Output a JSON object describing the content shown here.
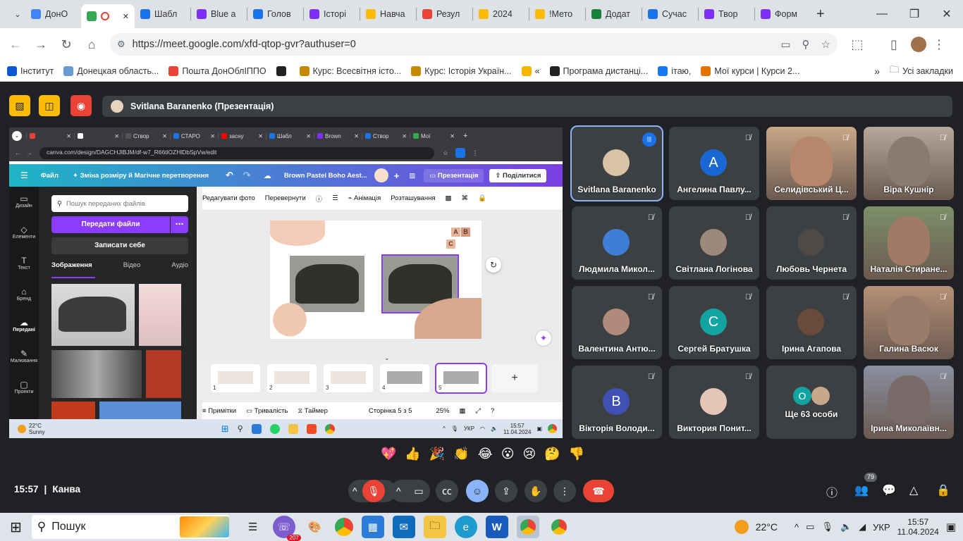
{
  "browser": {
    "tabs": [
      {
        "label": "ДонО",
        "color": "#4285f4"
      },
      {
        "label": "",
        "color": "#34a853",
        "active": true
      },
      {
        "label": "Шабл",
        "color": "#1a73e8"
      },
      {
        "label": "Blue a",
        "color": "#7b2ff7"
      },
      {
        "label": "Голов",
        "color": "#1a73e8"
      },
      {
        "label": "Історі",
        "color": "#7b2ff7"
      },
      {
        "label": "Навча",
        "color": "#fbbc04"
      },
      {
        "label": "Резул",
        "color": "#ea4335"
      },
      {
        "label": "2024",
        "color": "#fbbc04"
      },
      {
        "label": "!Мето",
        "color": "#fbbc04"
      },
      {
        "label": "Додат",
        "color": "#188038"
      },
      {
        "label": "Сучас",
        "color": "#1a73e8"
      },
      {
        "label": "Твор",
        "color": "#7b2ff7"
      },
      {
        "label": "Форм",
        "color": "#7b2ff7"
      }
    ],
    "url": "https://meet.google.com/xfd-qtop-gvr?authuser=0",
    "bookmarks": [
      {
        "label": "Інститут",
        "color": "#0b57d0"
      },
      {
        "label": "Донецкая область...",
        "color": "#6a9bd1"
      },
      {
        "label": "Пошта ДонОблІППО",
        "color": "#ea4335"
      },
      {
        "label": "",
        "color": "#222"
      },
      {
        "label": "Курс: Всесвітня істо...",
        "color": "#c58a00"
      },
      {
        "label": "Курс: Історія Україн...",
        "color": "#c58a00"
      },
      {
        "label": "«",
        "color": "#f4b400"
      },
      {
        "label": "Програма дистанці...",
        "color": "#222"
      },
      {
        "label": "ітаю,",
        "color": "#1877f2"
      },
      {
        "label": "Мої курси | Курси 2...",
        "color": "#e37400"
      }
    ],
    "all_bookmarks": "Усі закладки"
  },
  "meet": {
    "presenter_label": "Svitlana Baranenko (Презентація)",
    "participants": [
      {
        "name": "Svitlana Baranenko",
        "initial": "",
        "avatar_color": "#d9c3a5",
        "speaking": true
      },
      {
        "name": "Ангелина Павлу...",
        "initial": "A",
        "avatar_color": "#1967d2"
      },
      {
        "name": "Селидівський Ц...",
        "initial": "",
        "avatar_color": "#b8866a",
        "video": true,
        "bg": "#c9a787"
      },
      {
        "name": "Віра Кушнір",
        "initial": "",
        "avatar_color": "#8a7a70",
        "video": true,
        "bg": "#b5a89b"
      },
      {
        "name": "Людмила Микол...",
        "initial": "",
        "avatar_color": "#3f7ed6"
      },
      {
        "name": "Світлана Логінова",
        "initial": "",
        "avatar_color": "#9b8a7b"
      },
      {
        "name": "Любовь Чернета",
        "initial": "",
        "avatar_color": "#4e4a48"
      },
      {
        "name": "Наталія Стиране...",
        "initial": "",
        "avatar_color": "#a07a64",
        "video": true,
        "bg": "#7c8f6a"
      },
      {
        "name": "Валентина Антю...",
        "initial": "",
        "avatar_color": "#b08a7a"
      },
      {
        "name": "Сергей Братушка",
        "initial": "C",
        "avatar_color": "#12a4a0"
      },
      {
        "name": "Ірина Агапова",
        "initial": "",
        "avatar_color": "#6a4b3b"
      },
      {
        "name": "Галина Васюк",
        "initial": "",
        "avatar_color": "#9b7b6a",
        "video": true,
        "bg": "#b59077"
      },
      {
        "name": "Вікторія Володи...",
        "initial": "B",
        "avatar_color": "#3f51b5"
      },
      {
        "name": "Виктория Понит...",
        "initial": "",
        "avatar_color": "#e5c5b8"
      },
      {
        "name": "Ще 63 особи",
        "initial": "O",
        "avatar_color": "#12a4a0",
        "more": true
      },
      {
        "name": "Ірина Миколаївн...",
        "initial": "",
        "avatar_color": "#7a6a6a",
        "video": true,
        "bg": "#8a8fa0"
      }
    ],
    "reactions": [
      "💖",
      "👍",
      "🎉",
      "👏",
      "😂",
      "😮",
      "😢",
      "🤔",
      "👎"
    ],
    "time": "15:57",
    "separator": "|",
    "meeting_name": "Канва",
    "people_count": "79"
  },
  "shared_screen": {
    "tabs": [
      "",
      "",
      "Створ",
      "СТАРО",
      "засну",
      "Шабл",
      "Brown",
      "Створ",
      "Мої"
    ],
    "url": "canva.com/design/DAGCHJlBJM/df-w7_R66tlOZHlDbSpVw/edit",
    "menu": {
      "file": "Файл",
      "resize": "Зміна розміру й Магічне перетворення",
      "title": "Brown Pastel Boho Aest...",
      "present": "Презентація",
      "share": "Поділитися"
    },
    "sidebar": [
      {
        "label": "Дизайн",
        "icon": "▭"
      },
      {
        "label": "Елементи",
        "icon": "◇"
      },
      {
        "label": "Текст",
        "icon": "T"
      },
      {
        "label": "Бренд",
        "icon": "⌂"
      },
      {
        "label": "Передані",
        "icon": "☁"
      },
      {
        "label": "Малювання",
        "icon": "✎"
      },
      {
        "label": "Проекти",
        "icon": "▢"
      }
    ],
    "panel": {
      "search_placeholder": "Пошук переданих файлів",
      "upload": "Передати файли",
      "record": "Записати себе",
      "tabs": [
        "Зображення",
        "Відео",
        "Аудіо"
      ]
    },
    "edit_toolbar": {
      "edit_photo": "Редагувати фото",
      "flip": "Перевернути",
      "animation": "Анімація",
      "position": "Розташування"
    },
    "slide_letters": [
      "A",
      "B",
      "C"
    ],
    "thumbnails": [
      "1",
      "2",
      "3",
      "4",
      "5"
    ],
    "footer": {
      "notes": "Примітки",
      "duration": "Тривалість",
      "timer": "Таймер",
      "page": "Сторінка 5 з 5",
      "zoom": "25%"
    },
    "taskbar": {
      "temp": "22°C",
      "weather": "Sunny",
      "lang": "УКР",
      "time": "15:57",
      "date": "11.04.2024"
    }
  },
  "taskbar": {
    "search": "Пошук",
    "temp": "22°C",
    "lang": "УКР",
    "time": "15:57",
    "date": "11.04.2024",
    "badge": "207"
  }
}
